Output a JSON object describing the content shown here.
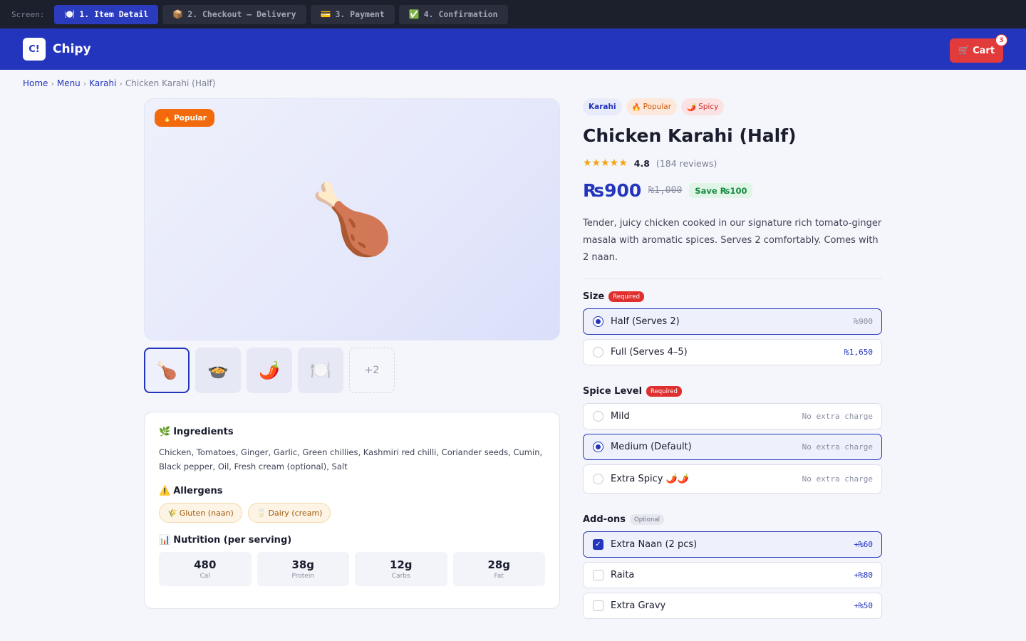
{
  "screens": {
    "label": "Screen:",
    "tabs": [
      {
        "icon": "🍽️",
        "label": "1. Item Detail"
      },
      {
        "icon": "📦",
        "label": "2. Checkout — Delivery"
      },
      {
        "icon": "💳",
        "label": "3. Payment"
      },
      {
        "icon": "✅",
        "label": "4. Confirmation"
      }
    ],
    "active_index": 0
  },
  "header": {
    "logo_mark": "C!",
    "brand": "Chipy",
    "cart_icon": "🛒",
    "cart_label": "Cart",
    "cart_count": "3"
  },
  "breadcrumb": {
    "items": [
      "Home",
      "Menu",
      "Karahi"
    ],
    "separator": "›",
    "current": "Chicken Karahi (Half)"
  },
  "gallery": {
    "badge_icon": "🔥",
    "badge_label": "Popular",
    "main_emoji": "🍗",
    "thumbs": [
      "🍗",
      "🍲",
      "🌶️",
      "🍽️"
    ],
    "more": "+2"
  },
  "info": {
    "ingredients_icon": "🌿",
    "ingredients_title": "Ingredients",
    "ingredients_text": "Chicken, Tomatoes, Ginger, Garlic, Green chillies, Kashmiri red chilli, Coriander seeds, Cumin, Black pepper, Oil, Fresh cream (optional), Salt",
    "allergens_icon": "⚠️",
    "allergens_title": "Allergens",
    "allergens": [
      {
        "icon": "🌾",
        "label": "Gluten (naan)"
      },
      {
        "icon": "🥛",
        "label": "Dairy (cream)"
      }
    ],
    "nutrition_icon": "📊",
    "nutrition_title": "Nutrition (per serving)",
    "nutrition": [
      {
        "value": "480",
        "unit": "Cal"
      },
      {
        "value": "38g",
        "unit": "Protein"
      },
      {
        "value": "12g",
        "unit": "Carbs"
      },
      {
        "value": "28g",
        "unit": "Fat"
      }
    ]
  },
  "product": {
    "tags": {
      "category": "Karahi",
      "popular_icon": "🔥",
      "popular": "Popular",
      "spicy_icon": "🌶️",
      "spicy": "Spicy"
    },
    "title": "Chicken Karahi (Half)",
    "stars": "★★★★★",
    "rating": "4.8",
    "reviews": "(184 reviews)",
    "price": "₨900",
    "old_price": "₨1,000",
    "save": "Save ₨100",
    "description": "Tender, juicy chicken cooked in our signature rich tomato-ginger masala with aromatic spices. Serves 2 comfortably. Comes with 2 naan."
  },
  "size": {
    "title": "Size",
    "badge": "Required",
    "options": [
      {
        "label": "Half (Serves 2)",
        "price": "₨900",
        "selected": true
      },
      {
        "label": "Full (Serves 4–5)",
        "price": "₨1,650",
        "selected": false
      }
    ]
  },
  "spice": {
    "title": "Spice Level",
    "badge": "Required",
    "options": [
      {
        "label": "Mild",
        "note": "No extra charge",
        "selected": false
      },
      {
        "label": "Medium (Default)",
        "note": "No extra charge",
        "selected": true
      },
      {
        "label": "Extra Spicy 🌶️🌶️",
        "note": "No extra charge",
        "selected": false
      }
    ]
  },
  "addons": {
    "title": "Add-ons",
    "badge": "Optional",
    "options": [
      {
        "label": "Extra Naan (2 pcs)",
        "price": "+₨60",
        "checked": true
      },
      {
        "label": "Raita",
        "price": "+₨80",
        "checked": false
      },
      {
        "label": "Extra Gravy",
        "price": "+₨50",
        "checked": false
      }
    ]
  },
  "colors": {
    "brand": "#2335bc",
    "cart": "#e23b3b",
    "popular": "#f26a0c",
    "save": "#1a8a45",
    "required": "#df2f2f"
  }
}
